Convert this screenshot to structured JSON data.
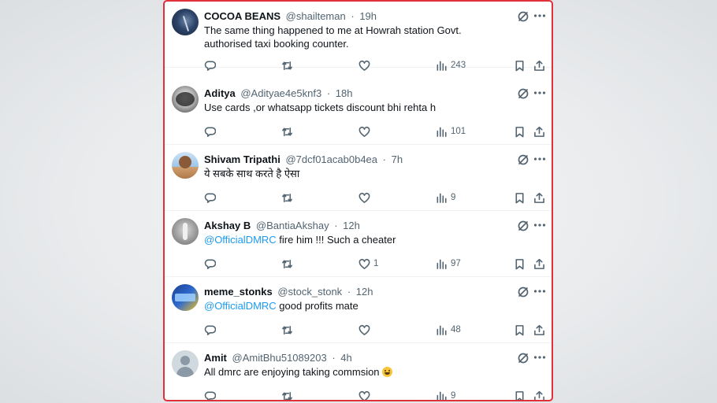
{
  "replies": [
    {
      "name": "COCOA BEANS",
      "handle": "@shailteman",
      "time": "19h",
      "text": "The same thing happened to me at Howrah station Govt. authorised taxi booking counter.",
      "mention": "",
      "likes": "",
      "views": "243",
      "avatar": "night-sky-photo"
    },
    {
      "name": "Aditya",
      "handle": "@Adityae4e5knf3",
      "time": "18h",
      "text": "Use cards ,or whatsapp tickets discount bhi rehta h",
      "mention": "",
      "likes": "",
      "views": "101",
      "avatar": "bw-portrait-photo"
    },
    {
      "name": "Shivam Tripathi",
      "handle": "@7dcf01acab0b4ea",
      "time": "7h",
      "text": "ये सबके साथ करते है ऐसा",
      "mention": "",
      "likes": "",
      "views": "9",
      "avatar": "selfie-photo"
    },
    {
      "name": "Akshay B",
      "handle": "@BantiaAkshay",
      "time": "12h",
      "text": " fire him !!! Such a cheater",
      "mention": "@OfficialDMRC",
      "likes": "1",
      "views": "97",
      "avatar": "statue-photo"
    },
    {
      "name": "meme_stonks",
      "handle": "@stock_stonk",
      "time": "12h",
      "text": " good profits mate",
      "mention": "@OfficialDMRC",
      "likes": "",
      "views": "48",
      "avatar": "meme-logo"
    },
    {
      "name": "Amit",
      "handle": "@AmitBhu51089203",
      "time": "4h",
      "text": "All dmrc are enjoying taking commsion ",
      "mention": "",
      "likes": "",
      "views": "9",
      "avatar": "default-profile-icon",
      "emoji": "grinning-face-emoji"
    }
  ],
  "separator": "·",
  "icons": {
    "grok": "grok-icon",
    "more": "more-options-icon",
    "reply": "reply-icon",
    "retweet": "retweet-icon",
    "like": "like-icon",
    "views": "views-icon",
    "bookmark": "bookmark-icon",
    "share": "share-icon"
  },
  "colors": {
    "highlight_border": "#e0303a",
    "mention": "#1d9bf0",
    "secondary_text": "#536471"
  }
}
